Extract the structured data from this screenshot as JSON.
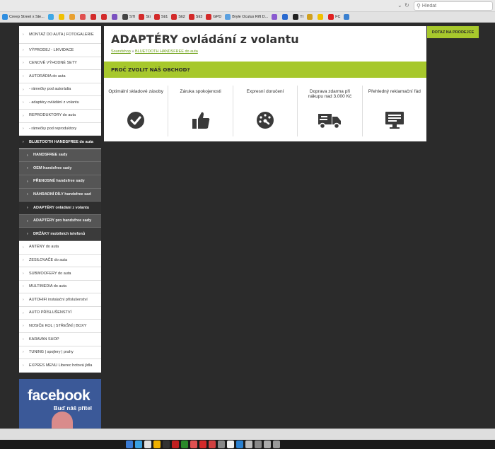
{
  "browser": {
    "search_placeholder": "Hledat",
    "bookmarks": [
      {
        "label": "Creep Street x Ste...",
        "color": "#2f8ee0"
      },
      {
        "label": "",
        "color": "#3fa8e6"
      },
      {
        "label": "",
        "color": "#f0c000"
      },
      {
        "label": "",
        "color": "#e8a030"
      },
      {
        "label": "",
        "color": "#e05050"
      },
      {
        "label": "",
        "color": "#d32a2a"
      },
      {
        "label": "",
        "color": "#d32a2a"
      },
      {
        "label": "",
        "color": "#7a50c0"
      },
      {
        "label": "STI",
        "color": "#444444"
      },
      {
        "label": "Sti",
        "color": "#d32a2a"
      },
      {
        "label": "Sti1",
        "color": "#d32a2a"
      },
      {
        "label": "Sti2",
        "color": "#d32a2a"
      },
      {
        "label": "Sti3",
        "color": "#d32a2a"
      },
      {
        "label": "GPD",
        "color": "#d32a2a"
      },
      {
        "label": "Bryle Oculus Rift D...",
        "color": "#5aa0e0"
      },
      {
        "label": "",
        "color": "#8a5ad0"
      },
      {
        "label": "",
        "color": "#2a6ad0"
      },
      {
        "label": "TI",
        "color": "#222222"
      },
      {
        "label": "",
        "color": "#d0a020"
      },
      {
        "label": "",
        "color": "#f0c000"
      },
      {
        "label": "FC",
        "color": "#e02020"
      },
      {
        "label": "",
        "color": "#3a80d0"
      }
    ]
  },
  "sidebar": {
    "items": [
      {
        "label": "MONTÁŽ DO AUTA | FOTOGALERIE",
        "type": "tall"
      },
      {
        "label": "VÝPRODEJ - LIKVIDACE",
        "type": "normal"
      },
      {
        "label": "CENOVĚ VÝHODNÉ SETY",
        "type": "normal"
      },
      {
        "label": "AUTORÁDIA do auta",
        "type": "normal"
      },
      {
        "label": "- rámečky pod autorádia",
        "type": "normal"
      },
      {
        "label": "- adaptéry ovládání z volantu",
        "type": "normal"
      },
      {
        "label": "REPRODUKTORY do auta",
        "type": "normal"
      },
      {
        "label": "- rámečky pod reproduktory",
        "type": "normal"
      },
      {
        "label": "BLUETOOTH HANDSFREE do auta",
        "type": "active"
      },
      {
        "label": "HANDSFREE sady",
        "type": "sub"
      },
      {
        "label": "OEM handsfree sady",
        "type": "sub"
      },
      {
        "label": "PŘENOSNÉ handsfree sady",
        "type": "sub"
      },
      {
        "label": "NÁHRADNÍ DÍLY handsfree sad",
        "type": "sub"
      },
      {
        "label": "ADAPTÉRY ovládání z volantu",
        "type": "sub-current"
      },
      {
        "label": "ADAPTÉRY pro handsfree sady",
        "type": "sub"
      },
      {
        "label": "DRŽÁKY mobilních telefonů",
        "type": "sub-dark"
      },
      {
        "label": "ANTÉNY do auta",
        "type": "normal"
      },
      {
        "label": "ZESILOVAČE do auta",
        "type": "normal"
      },
      {
        "label": "SUBWOOFERY do auta",
        "type": "normal"
      },
      {
        "label": "MULTIMEDIA do auta",
        "type": "normal"
      },
      {
        "label": "AUTOHIFI instalační příslušenství",
        "type": "normal"
      },
      {
        "label": "AUTO PŘÍSLUŠENSTVÍ",
        "type": "normal"
      },
      {
        "label": "NOSIČE KOL | STŘEŠNÍ | BOXY",
        "type": "normal"
      },
      {
        "label": "KARAVAN SHOP",
        "type": "normal"
      },
      {
        "label": "TUNING | spojlery | prahy",
        "type": "normal"
      },
      {
        "label": "EXPRES MENU Liberec hotová jídla",
        "type": "normal"
      }
    ],
    "facebook": {
      "logo": "facebook",
      "tagline": "Buď náš přítel"
    }
  },
  "main": {
    "title": "ADAPTÉRY ovládání z volantu",
    "breadcrumb": {
      "home": "Soundshop",
      "separator": "»",
      "parent": "BLUETOOTH HANDSFREE do auta"
    },
    "why_heading": "PROČ ZVOLIT NÁŠ OBCHOD?",
    "features": [
      {
        "label": "Optimální skladové zásoby",
        "icon": "check-circle-icon"
      },
      {
        "label": "Záruka spokojenosti",
        "icon": "thumbs-up-icon"
      },
      {
        "label": "Expresní doručení",
        "icon": "speedometer-icon"
      },
      {
        "label": "Doprava zdarma při nákupu nad 3.000 Kč",
        "icon": "truck-icon"
      },
      {
        "label": "Přehledný reklamační řád",
        "icon": "monitor-icon"
      }
    ]
  },
  "contact_button": "DOTAZ NA PRODEJCE",
  "colors": {
    "accent": "#a7c82c",
    "sidebar_active": "#2a2a2a",
    "sub_item": "#555555",
    "page_bg": "#2b2b2b"
  }
}
